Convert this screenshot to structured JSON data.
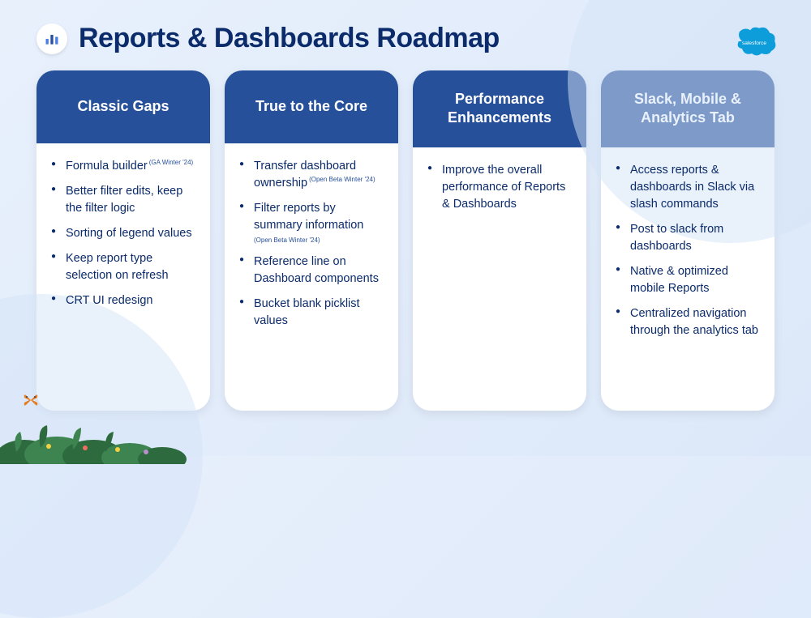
{
  "page_title": "Reports & Dashboards Roadmap",
  "logo_text": "salesforce",
  "cards": [
    {
      "title": "Classic Gaps",
      "items": [
        {
          "text": "Formula builder",
          "tag": "(GA Winter '24)"
        },
        {
          "text": "Better filter edits, keep the filter logic"
        },
        {
          "text": "Sorting of legend values"
        },
        {
          "text": "Keep report type selection on refresh"
        },
        {
          "text": "CRT UI redesign"
        }
      ]
    },
    {
      "title": "True to the Core",
      "items": [
        {
          "text": "Transfer dashboard ownership",
          "tag": "(Open Beta Winter '24)"
        },
        {
          "text": "Filter reports by summary information",
          "tag_block": "(Open Beta Winter '24)"
        },
        {
          "text": "Reference line on Dashboard components"
        },
        {
          "text": "Bucket blank picklist values"
        }
      ]
    },
    {
      "title": "Performance Enhancements",
      "items": [
        {
          "text": "Improve the overall performance of Reports & Dashboards"
        }
      ]
    },
    {
      "title": "Slack, Mobile & Analytics Tab",
      "items": [
        {
          "text": "Access reports & dashboards in Slack via slash commands"
        },
        {
          "text": "Post to slack from dashboards"
        },
        {
          "text": "Native & optimized mobile Reports"
        },
        {
          "text": "Centralized navigation through the analytics tab"
        }
      ]
    }
  ]
}
